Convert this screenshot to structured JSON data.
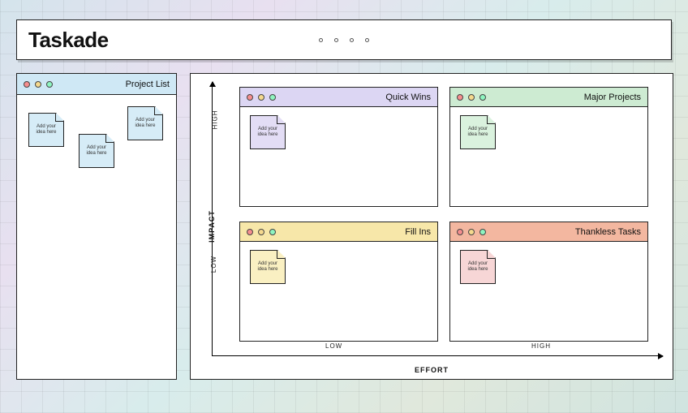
{
  "header": {
    "title": "Taskade"
  },
  "sidebar": {
    "title": "Project List",
    "notes": [
      {
        "text": "Add your idea here"
      },
      {
        "text": "Add your idea here"
      },
      {
        "text": "Add your idea here"
      }
    ]
  },
  "matrix": {
    "impact_label": "IMPACT",
    "effort_label": "EFFORT",
    "ticks": {
      "high": "HIGH",
      "low": "LOW"
    },
    "quadrants": [
      {
        "key": "quick_wins",
        "title": "Quick Wins",
        "note": "Add your idea here"
      },
      {
        "key": "major_projects",
        "title": "Major Projects",
        "note": "Add your idea here"
      },
      {
        "key": "fill_ins",
        "title": "Fill Ins",
        "note": "Add your idea here"
      },
      {
        "key": "thankless_tasks",
        "title": "Thankless Tasks",
        "note": "Add your idea here"
      }
    ]
  }
}
